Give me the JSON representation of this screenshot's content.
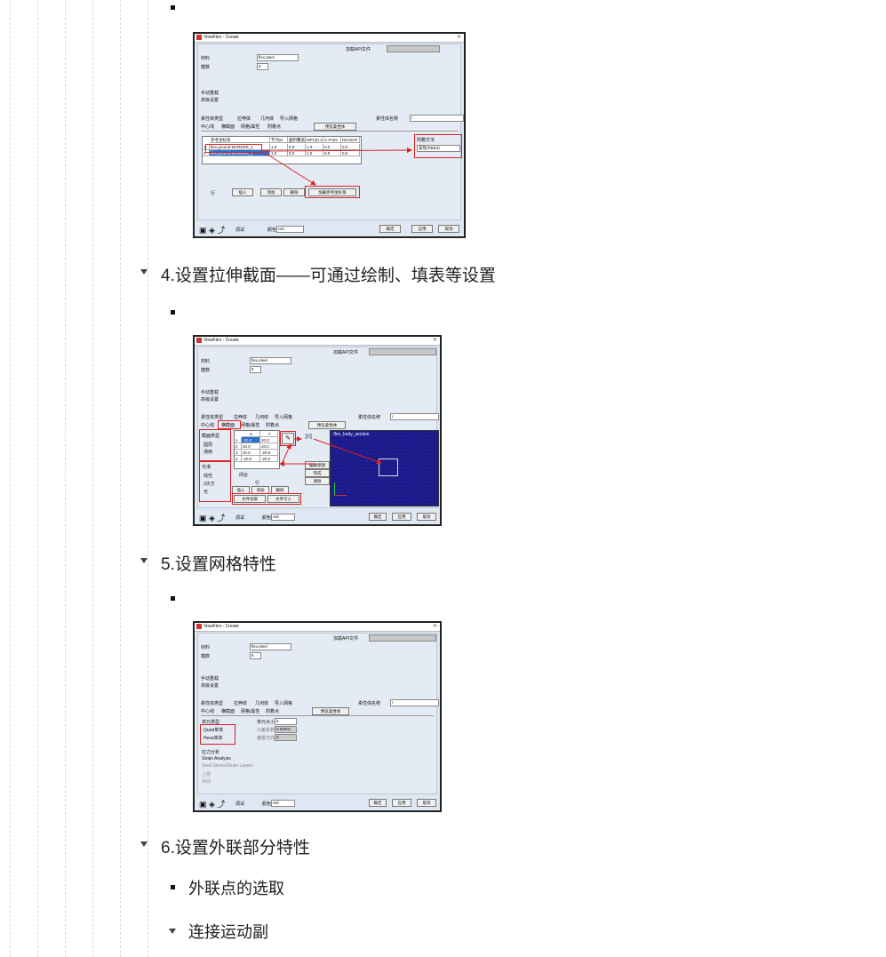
{
  "headings": {
    "h4": "4.设置拉伸截面——可通过绘制、填表等设置",
    "h5": "5.设置网格特性",
    "h6": "6.设置外联部分特性",
    "h6a": "外联点的选取",
    "h6b": "连接运动副"
  },
  "dialog": {
    "title": "ViewFlex - Create",
    "api_label": "加载API文件",
    "material_label": "材料",
    "material_value": "flex.steel",
    "modes_label": "模数",
    "modes_value": "6",
    "opt_manual": "手动重载",
    "opt_advanced": "高级设置",
    "flex_type_label": "柔性体类型",
    "type_extrude": "拉伸体",
    "type_geometry": "几何体",
    "type_import": "导入网格",
    "flex_name_label": "柔性体名称",
    "flex_name_value": "r",
    "tab_center": "中心线",
    "tab_section": "横截面",
    "tab_mesh": "网格/属性",
    "tab_attach": "附着点",
    "preview_btn": "预览柔性体",
    "ok": "确定",
    "apply": "应用",
    "cancel": "取消",
    "debug": "调试",
    "color_label": "颜色",
    "color_value": "red"
  },
  "shot1": {
    "table_headers": [
      "参考坐标系",
      "节点ID",
      "面积覆盖",
      "MPC[0.1",
      "C.Point",
      "Rel.DOF"
    ],
    "rows": [
      [
        "1",
        "flex.ground.MARKER_1",
        "1.0",
        "0.0",
        "1.0",
        "0.0",
        "0.0"
      ],
      [
        "2",
        "flex.ground.MARKER_2",
        "1.0",
        "0.0",
        "1.0",
        "0.0",
        "0.0"
      ]
    ],
    "attach_method_label": "附着方法",
    "attach_method_value": "柔性(RBE3)",
    "row_label": "行",
    "insert": "插入",
    "add": "添加",
    "delete": "删除",
    "add_ref": "加载参考坐标系"
  },
  "shot2": {
    "section_type_label": "截面类型",
    "sec_general": "圆周",
    "sec_generic": "通用",
    "smooth_label": "光滑",
    "sm_linear": "线性",
    "sm_cubic": "3次方",
    "sm_none": "无",
    "col_x": "X",
    "col_y": "Y",
    "points": [
      [
        "1",
        "-20.0",
        "20.0"
      ],
      [
        "2",
        "20.0",
        "20.0"
      ],
      [
        "3",
        "20.0",
        "-20.0"
      ],
      [
        "4",
        "-20.0",
        "-20.0"
      ]
    ],
    "closed": "闭合",
    "row_label": "行",
    "insert": "插入",
    "add": "添加",
    "delete": "删除",
    "read_file": "文件读取",
    "write_file": "文件写入",
    "edit_section": "编辑草图",
    "finish": "完成",
    "clear": "清除",
    "canvas_title": ".flex_body_section"
  },
  "shot3": {
    "elem_type_label": "单元类型",
    "quad": "Quad单体",
    "hexa": "Hexa单体",
    "elem_size_label": "单元大小",
    "elem_size_value": "5",
    "order_label": "公差系数",
    "order_value": "0.00001",
    "order_dir_label": "偏置方向",
    "order_dir_value": "Z",
    "stress": "应力分析",
    "strain": "Strain Analysis",
    "shell_layer": "Shell Stress/Strain Layers",
    "top": "上层",
    "bottom": "中间"
  }
}
